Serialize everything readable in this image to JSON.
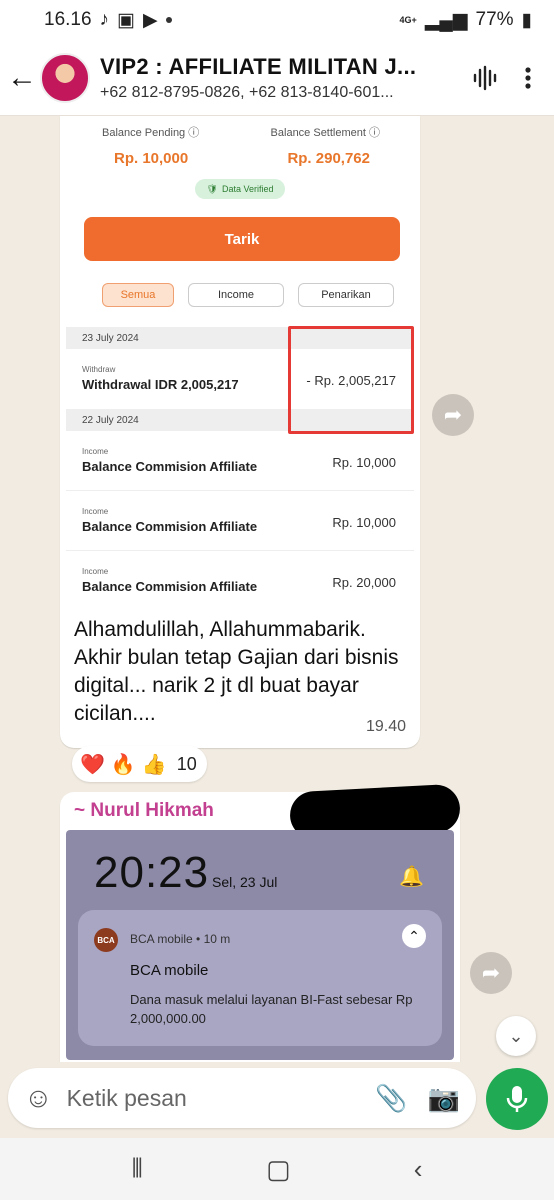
{
  "status_bar": {
    "time": "16.16",
    "network": "4G+",
    "battery": "77%"
  },
  "header": {
    "title": "VIP2 : AFFILIATE MILITAN J...",
    "subtitle": "+62 812-8795-0826, +62 813-8140-601..."
  },
  "message1": {
    "screenshot": {
      "balance_pending_label": "Balance Pending",
      "balance_settlement_label": "Balance Settlement",
      "balance_pending_value": "Rp. 10,000",
      "balance_settlement_value": "Rp. 290,762",
      "verified_label": "Data Verified",
      "withdraw_button": "Tarik",
      "filters": [
        "Semua",
        "Income",
        "Penarikan"
      ],
      "groups": [
        {
          "date": "23 July 2024",
          "items": [
            {
              "kind": "Withdraw",
              "desc": "Withdrawal IDR 2,005,217",
              "amount": "- Rp. 2,005,217"
            }
          ]
        },
        {
          "date": "22 July 2024",
          "items": [
            {
              "kind": "Income",
              "desc": "Balance Commision Affiliate",
              "amount": "Rp. 10,000"
            },
            {
              "kind": "Income",
              "desc": "Balance Commision Affiliate",
              "amount": "Rp. 10,000"
            },
            {
              "kind": "Income",
              "desc": "Balance Commision Affiliate",
              "amount": "Rp. 20,000"
            }
          ]
        }
      ]
    },
    "caption": "Alhamdulillah, Allahummabarik. Akhir bulan tetap Gajian dari bisnis digital... narik 2 jt dl buat bayar cicilan....",
    "time": "19.40",
    "reactions": [
      "❤️",
      "🔥",
      "👍"
    ],
    "reaction_count": "10"
  },
  "message2": {
    "sender": "~ Nurul Hikmah",
    "lockscreen": {
      "clock": "20:23",
      "date": "Sel, 23 Jul",
      "notification": {
        "app_logo": "BCA",
        "app_line": "BCA mobile • 10 m",
        "title": "BCA mobile",
        "body": "Dana masuk melalui layanan BI-Fast sebesar Rp 2,000,000.00"
      }
    }
  },
  "composer": {
    "placeholder": "Ketik pesan"
  },
  "colors": {
    "accent_orange": "#ef6c2e",
    "whatsapp_green": "#1faa53",
    "sender_pink": "#c2408f"
  }
}
